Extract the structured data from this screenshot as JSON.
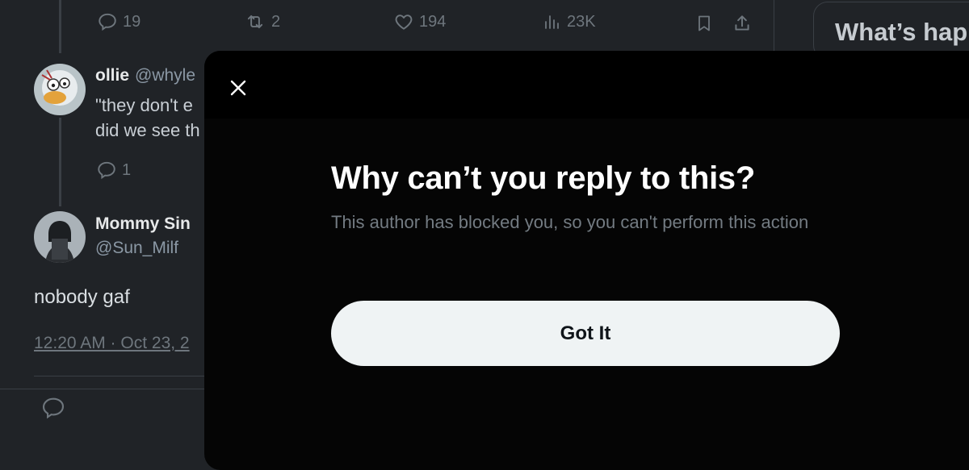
{
  "stats_bar": {
    "replies": "19",
    "reposts": "2",
    "likes": "194",
    "views": "23K"
  },
  "reply1": {
    "name": "ollie",
    "handle": "@whyle",
    "line1": "\"they don't e",
    "line2": "did we see th",
    "reply_count": "1"
  },
  "reply2": {
    "name": "Mommy Sin",
    "handle": "@Sun_Milf",
    "text": "nobody gaf",
    "timestamp": "12:20 AM · Oct 23, 2"
  },
  "sidebar": {
    "trends_title": "What’s hap"
  },
  "modal": {
    "title": "Why can’t you reply to this?",
    "message": "This author has blocked you, so you can't perform this action",
    "button_label": "Got It"
  },
  "colors": {
    "background": "#202327",
    "modal_background": "#050505",
    "button_background": "#eff3f4",
    "muted_text": "#6e767d"
  }
}
